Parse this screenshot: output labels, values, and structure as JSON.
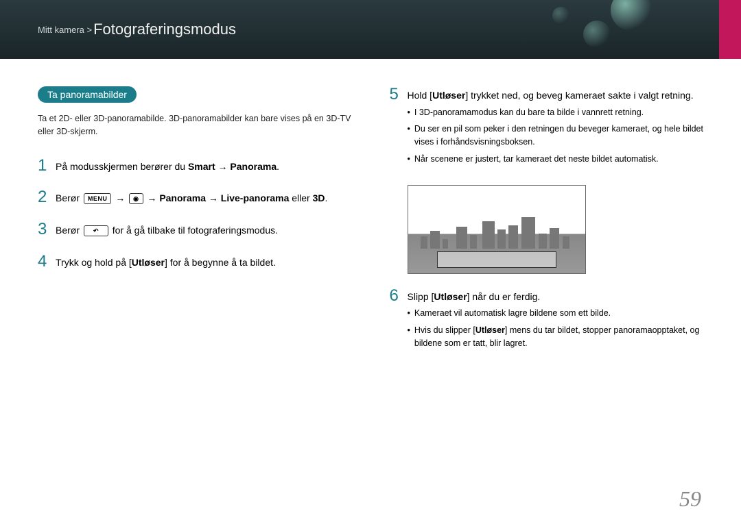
{
  "header": {
    "breadcrumb": "Mitt kamera >",
    "title": "Fotograferingsmodus"
  },
  "left": {
    "pill": "Ta panoramabilder",
    "intro": "Ta et 2D- eller 3D-panoramabilde. 3D-panoramabilder kan bare vises på en 3D-TV eller 3D-skjerm.",
    "steps": {
      "s1_a": "På modusskjermen berører du ",
      "s1_b": "Smart → Panorama",
      "s1_c": ".",
      "s2_a": "Berør ",
      "s2_menu": "MENU",
      "s2_mid": " → ",
      "s2_cam": "◉",
      "s2_b": " → ",
      "s2_bold": "Panorama → Live-panorama",
      "s2_c": " eller ",
      "s2_d": "3D",
      "s2_e": ".",
      "s3_a": "Berør ",
      "s3_back": "↶",
      "s3_b": " for å gå tilbake til fotograferingsmodus.",
      "s4_a": "Trykk og hold på [",
      "s4_b": "Utløser",
      "s4_c": "] for å begynne å ta bildet."
    }
  },
  "right": {
    "s5_a": "Hold [",
    "s5_b": "Utløser",
    "s5_c": "] trykket ned, og beveg kameraet sakte i valgt retning.",
    "b5_1": "I 3D-panoramamodus kan du bare ta bilde i vannrett retning.",
    "b5_2": "Du ser en pil som peker i den retningen du beveger kameraet, og hele bildet vises i forhåndsvisningsboksen.",
    "b5_3": "Når scenene er justert, tar kameraet det neste bildet automatisk.",
    "s6_a": "Slipp [",
    "s6_b": "Utløser",
    "s6_c": "] når du er ferdig.",
    "b6_1": "Kameraet vil automatisk lagre bildene som ett bilde.",
    "b6_2_a": "Hvis du slipper [",
    "b6_2_b": "Utløser",
    "b6_2_c": "] mens du tar bildet, stopper panoramaopptaket, og bildene som er tatt, blir lagret."
  },
  "nums": {
    "n1": "1",
    "n2": "2",
    "n3": "3",
    "n4": "4",
    "n5": "5",
    "n6": "6"
  },
  "page": "59"
}
